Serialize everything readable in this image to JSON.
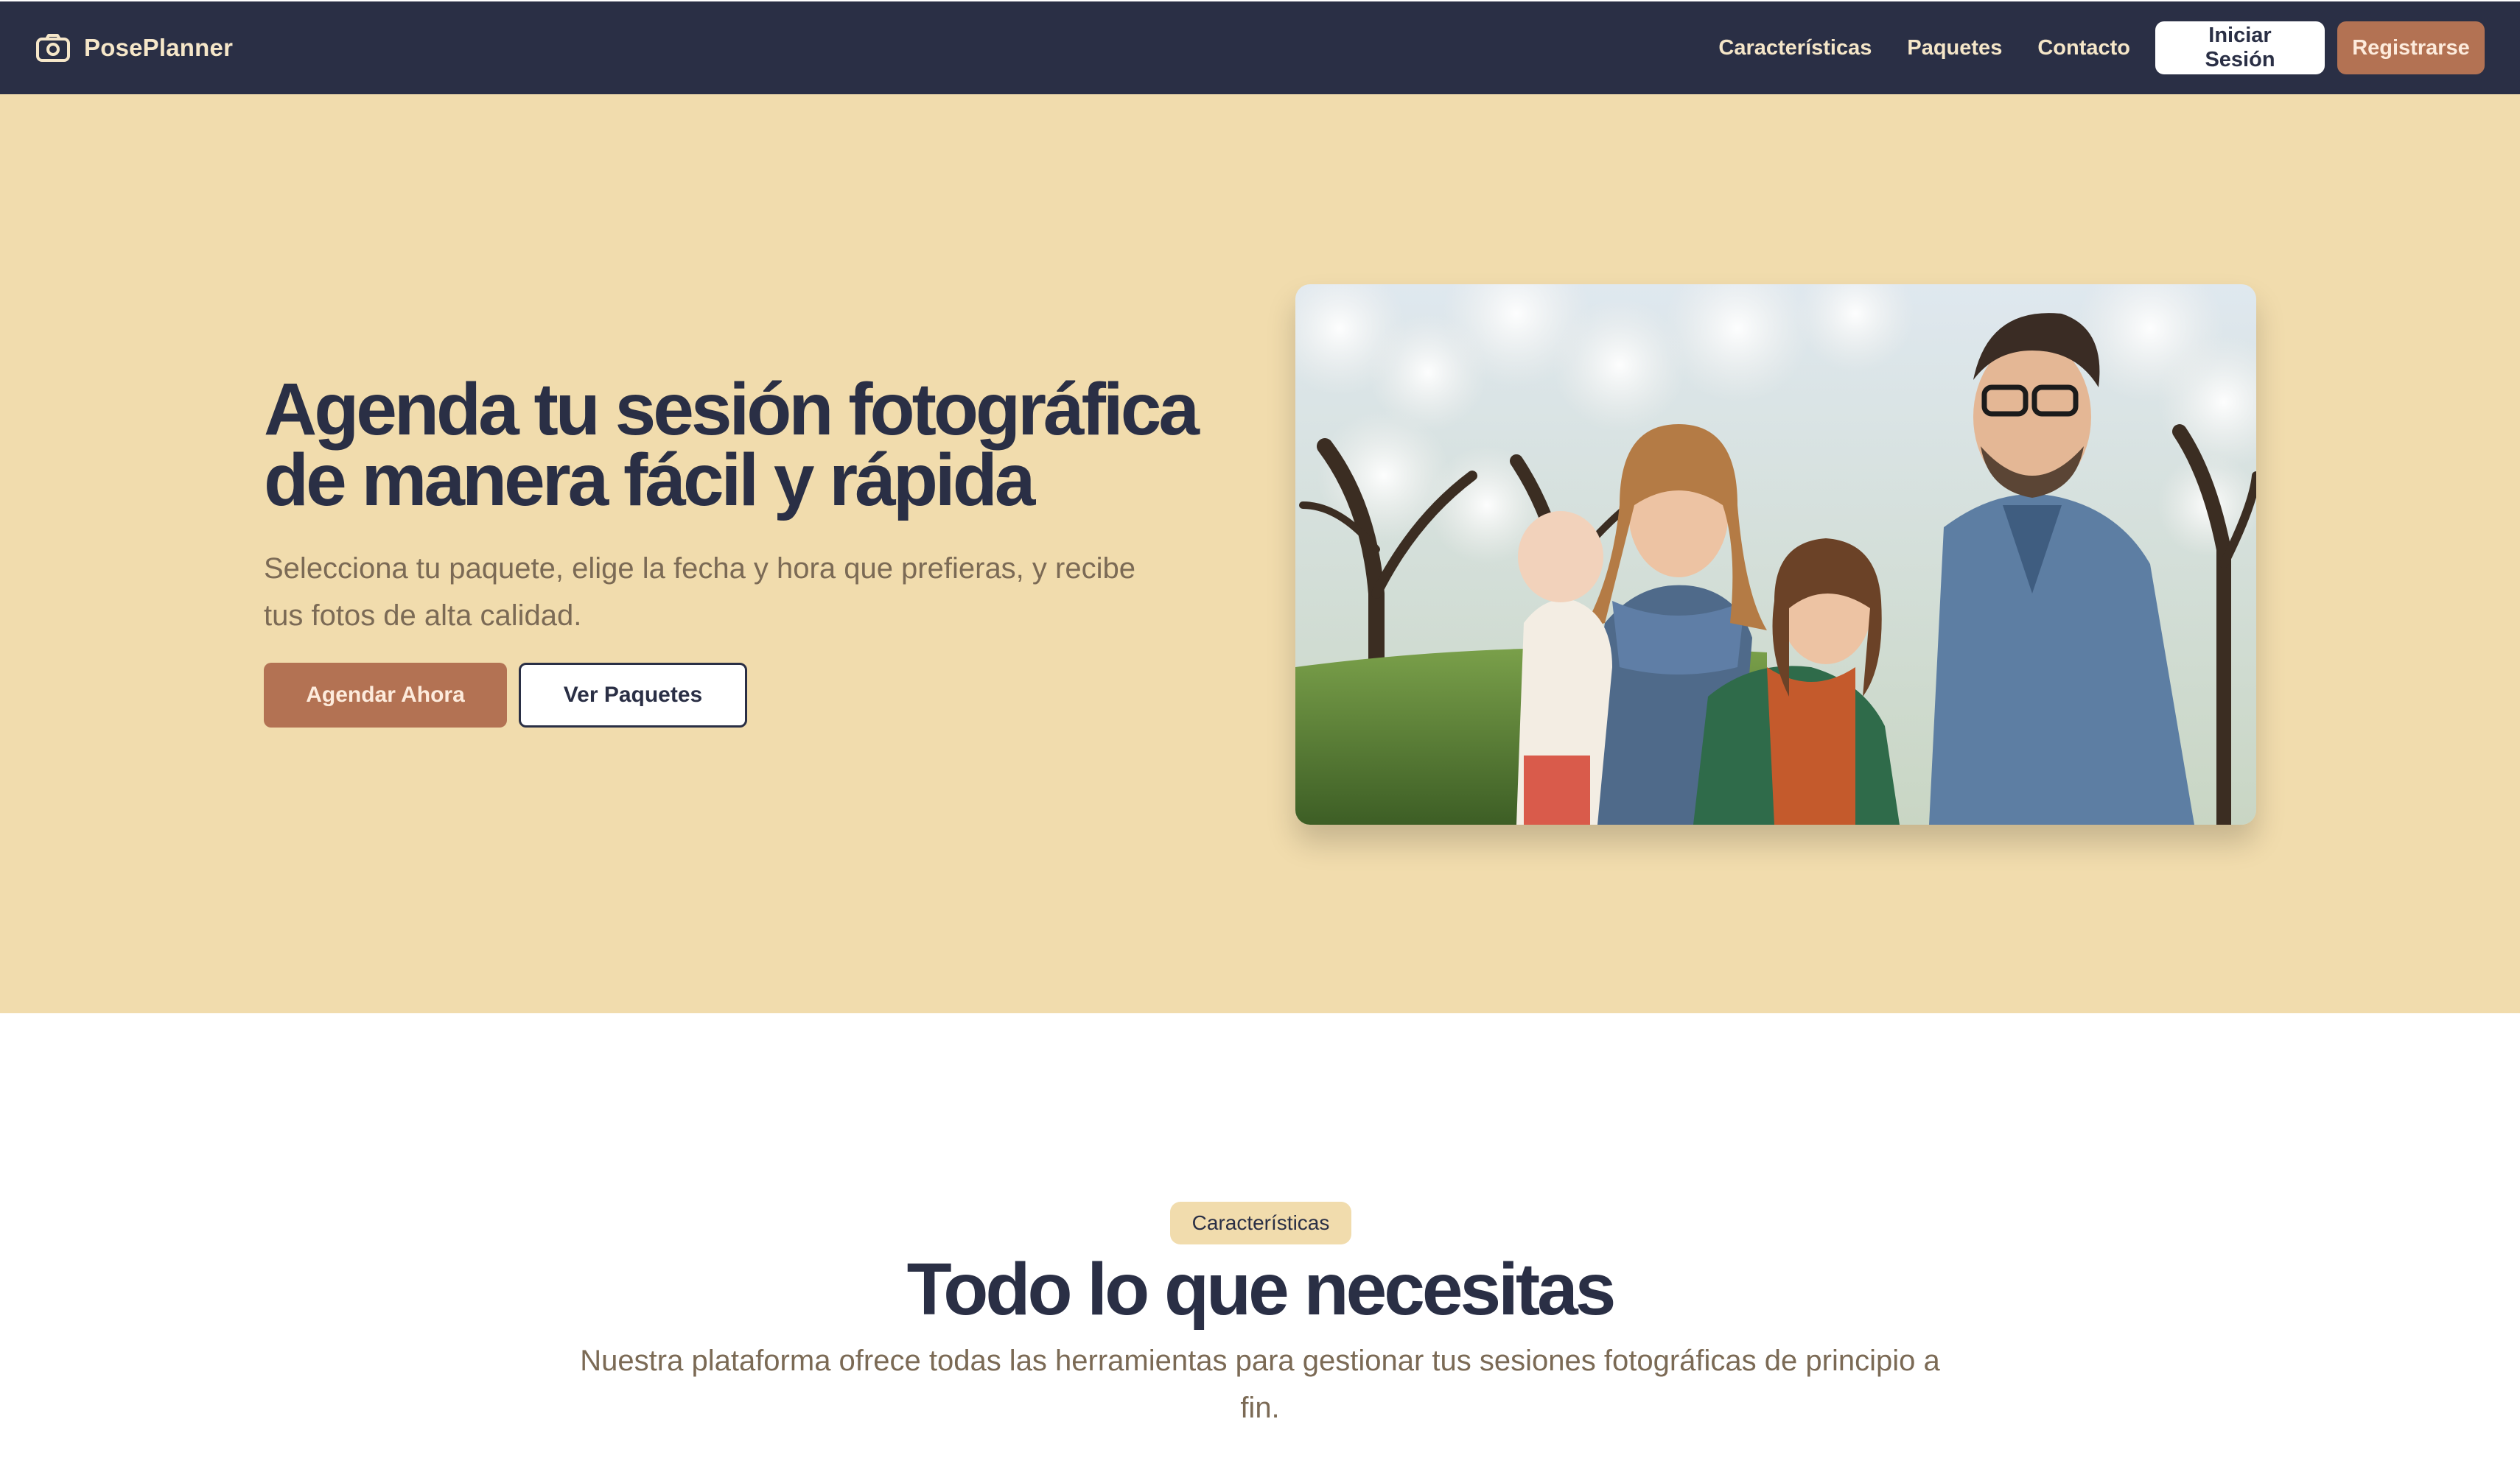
{
  "brand": {
    "name": "PosePlanner",
    "icon": "camera-icon"
  },
  "nav": {
    "items": [
      {
        "label": "Características"
      },
      {
        "label": "Paquetes"
      },
      {
        "label": "Contacto"
      }
    ],
    "login_label": "Iniciar Sesión",
    "register_label": "Registrarse"
  },
  "hero": {
    "title_line1": "Agenda tu sesión fotográfica",
    "title_line2": "de manera fácil y rápida",
    "subtitle": "Selecciona tu paquete, elige la fecha y hora que prefieras, y recibe tus fotos de alta calidad.",
    "primary_button": "Agendar Ahora",
    "secondary_button": "Ver Paquetes"
  },
  "features": {
    "badge": "Características",
    "title": "Todo lo que necesitas",
    "subtitle": "Nuestra plataforma ofrece todas las herramientas para gestionar tus sesiones fotográficas de principio a fin."
  },
  "colors": {
    "navbar_bg": "#2a2f45",
    "hero_bg": "#f1dcad",
    "accent": "#b37253",
    "text_dark": "#2a2f45",
    "text_muted": "#7b6a55"
  }
}
